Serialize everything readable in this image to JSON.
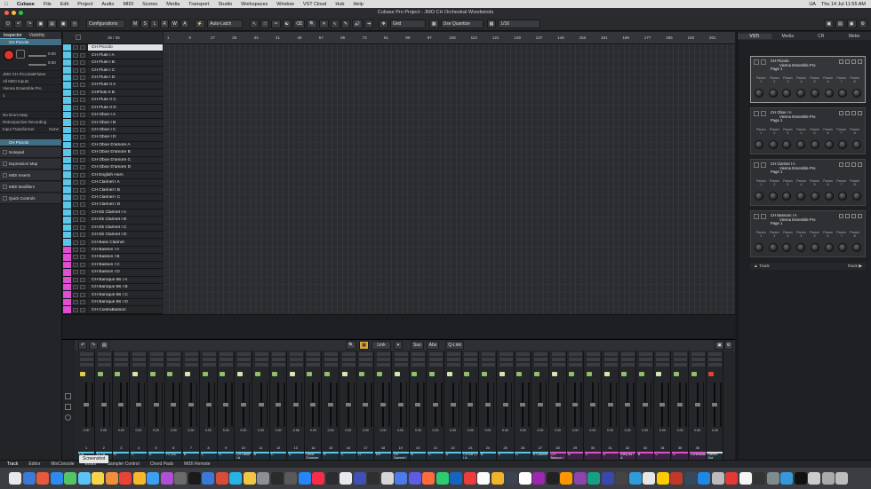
{
  "menubar": {
    "app": "Cubase",
    "items": [
      "File",
      "Edit",
      "Project",
      "Audio",
      "MIDI",
      "Scores",
      "Media",
      "Transport",
      "Studio",
      "Workspaces",
      "Window",
      "VST Cloud",
      "Hub",
      "Help"
    ],
    "clock": "Thu 14 Jul  11:55 AM",
    "lang": "UA"
  },
  "window": {
    "title": "Cubase Pro Project - JMO CH Orchestral Woodwinds"
  },
  "toolbar": {
    "configurations": "Configurations",
    "msrw": [
      "M",
      "S",
      "L",
      "R",
      "W",
      "A"
    ],
    "automation": "Auto-Latch",
    "grid": "Grid",
    "quantize_mode": "Use Quantize",
    "quantize": "1/16"
  },
  "inspector": {
    "tabs": [
      "Inspector",
      "Visibility"
    ],
    "track": "CH Piccolo",
    "vol": "0.00",
    "pan": "0.00",
    "rows": [
      "JMO CH Piccolo&Flutes",
      "All MIDI Inputs",
      "Vienna Ensemble Pro",
      "1",
      "No Drum Map"
    ],
    "retro": "Retrospective Recording",
    "input_transformer": "Input Transformer",
    "input_transformer_val": "None",
    "routing_track": "CH Piccolo",
    "sections": [
      "Notepad",
      "Expression Map",
      "MIDI Inserts",
      "MIDI Modifiers",
      "Quick Controls"
    ]
  },
  "tracklist": {
    "counter": "36 / 36",
    "tracks": [
      "CH Piccolo",
      "CH Flute I A",
      "CH Flute I B",
      "CH Flute I C",
      "CH Flute I D",
      "CH Flute II A",
      "CHFlute II B",
      "CH Flute II C",
      "CH Flute II D",
      "CH Oboe I A",
      "CH Oboe I B",
      "CH Oboe I C",
      "CH Oboe I D",
      "CH Oboe D'amore A",
      "CH Oboe D'amore B",
      "CH Oboe D'amore C",
      "CH Oboe D'amore D",
      "CH English Horn",
      "CH Clarinet I A",
      "CH Clarinet I B",
      "CH Clarinet I C",
      "CH Clarinet I D",
      "CH Eb Clarinet I A",
      "CH Eb Clarinet I B",
      "CH Eb Clarinet I C",
      "CH Eb Clarinet I D",
      "CH Bass Clarinet",
      "CH Basson I A",
      "CH Basson I B",
      "CH Basson I C",
      "CH Basson I D",
      "CH Baroque Bs I A",
      "CH Baroque Bs I B",
      "CH Baroque Bs I C",
      "CH Baroque Bs I D",
      "CH ContraBasson"
    ],
    "colors": [
      "#5bc6e8",
      "#5bc6e8",
      "#5bc6e8",
      "#5bc6e8",
      "#5bc6e8",
      "#5bc6e8",
      "#5bc6e8",
      "#5bc6e8",
      "#5bc6e8",
      "#5bc6e8",
      "#5bc6e8",
      "#5bc6e8",
      "#5bc6e8",
      "#5bc6e8",
      "#5bc6e8",
      "#5bc6e8",
      "#5bc6e8",
      "#5bc6e8",
      "#5bc6e8",
      "#5bc6e8",
      "#5bc6e8",
      "#5bc6e8",
      "#5bc6e8",
      "#5bc6e8",
      "#5bc6e8",
      "#5bc6e8",
      "#5bc6e8",
      "#e04fd0",
      "#e04fd0",
      "#e04fd0",
      "#e04fd0",
      "#e04fd0",
      "#e04fd0",
      "#e04fd0",
      "#e04fd0",
      "#e04fd0"
    ]
  },
  "ruler": {
    "bars": [
      "1",
      "9",
      "17",
      "25",
      "33",
      "41",
      "49",
      "57",
      "65",
      "73",
      "81",
      "89",
      "97",
      "105",
      "113",
      "121",
      "129",
      "137",
      "145",
      "153",
      "161",
      "169",
      "177",
      "185",
      "193",
      "201"
    ]
  },
  "vsti": {
    "tabs": [
      "VSTi",
      "Media",
      "CR",
      "Meter"
    ],
    "slots": [
      {
        "name": "CH Piccolo",
        "plugin": "Vienna Ensemble Pro",
        "page": "Page 1"
      },
      {
        "name": "CH Oboe I A",
        "plugin": "Vienna Ensemble Pro",
        "page": "Page 1"
      },
      {
        "name": "CH Clarinet I A",
        "plugin": "Vienna Ensemble Pro",
        "page": "Page 1"
      },
      {
        "name": "CH Bassoon I A",
        "plugin": "Vienna Ensemble Pro",
        "page": "Page 1"
      }
    ],
    "param_label": "Param",
    "param_nums": [
      "1",
      "2",
      "3",
      "4",
      "5",
      "6",
      "7",
      "8"
    ],
    "footer_left": "Track",
    "footer_right": "Rack"
  },
  "mixer": {
    "link": "Link",
    "sus": "Sus",
    "abs": "Abs",
    "qlink": "Q-Link",
    "channels": [
      {
        "num": "1",
        "label": "CH Piccolo",
        "val": "0.00",
        "color": "#5bc6e8"
      },
      {
        "num": "2",
        "label": "FL I A",
        "val": "0.00",
        "color": "#5bc6e8"
      },
      {
        "num": "3",
        "label": "B",
        "val": "0.00",
        "color": "#5bc6e8"
      },
      {
        "num": "4",
        "label": "C",
        "val": "0.00",
        "color": "#5bc6e8"
      },
      {
        "num": "5",
        "label": "D",
        "val": "0.00",
        "color": "#5bc6e8"
      },
      {
        "num": "6",
        "label": "FL II A",
        "val": "0.00",
        "color": "#5bc6e8"
      },
      {
        "num": "7",
        "label": "B",
        "val": "0.00",
        "color": "#5bc6e8"
      },
      {
        "num": "8",
        "label": "C",
        "val": "0.00",
        "color": "#5bc6e8"
      },
      {
        "num": "9",
        "label": "D",
        "val": "5.49",
        "color": "#5bc6e8"
      },
      {
        "num": "10",
        "label": "CH Oboe I A",
        "val": "0.00",
        "color": "#5bc6e8"
      },
      {
        "num": "11",
        "label": "B",
        "val": "0.00",
        "color": "#5bc6e8"
      },
      {
        "num": "12",
        "label": "C",
        "val": "0.00",
        "color": "#5bc6e8"
      },
      {
        "num": "13",
        "label": "D",
        "val": "-0.56",
        "color": "#5bc6e8"
      },
      {
        "num": "14",
        "label": "Oboe D'amore",
        "val": "0.00",
        "color": "#5bc6e8"
      },
      {
        "num": "15",
        "label": "B",
        "val": "0.00",
        "color": "#5bc6e8"
      },
      {
        "num": "16",
        "label": "C",
        "val": "0.00",
        "color": "#5bc6e8"
      },
      {
        "num": "17",
        "label": "D",
        "val": "0.00",
        "color": "#5bc6e8"
      },
      {
        "num": "18",
        "label": "EH",
        "val": "0.00",
        "color": "#5bc6e8"
      },
      {
        "num": "19",
        "label": "CH Clarinet I",
        "val": "0.00",
        "color": "#5bc6e8"
      },
      {
        "num": "20",
        "label": "B",
        "val": "0.00",
        "color": "#5bc6e8"
      },
      {
        "num": "21",
        "label": "C",
        "val": "0.00",
        "color": "#5bc6e8"
      },
      {
        "num": "22",
        "label": "D",
        "val": "0.00",
        "color": "#5bc6e8"
      },
      {
        "num": "23",
        "label": "CH Eb Cl I A",
        "val": "0.00",
        "color": "#5bc6e8"
      },
      {
        "num": "24",
        "label": "B",
        "val": "0.00",
        "color": "#5bc6e8"
      },
      {
        "num": "25",
        "label": "C",
        "val": "0.00",
        "color": "#5bc6e8"
      },
      {
        "num": "26",
        "label": "D",
        "val": "0.00",
        "color": "#5bc6e8"
      },
      {
        "num": "27",
        "label": "B Clarinet",
        "val": "0.00",
        "color": "#5bc6e8"
      },
      {
        "num": "28",
        "label": "CH Basson I",
        "val": "0.00",
        "color": "#e04fd0"
      },
      {
        "num": "29",
        "label": "B",
        "val": "0.00",
        "color": "#e04fd0"
      },
      {
        "num": "30",
        "label": "C",
        "val": "0.00",
        "color": "#e04fd0"
      },
      {
        "num": "31",
        "label": "D",
        "val": "0.00",
        "color": "#e04fd0"
      },
      {
        "num": "32",
        "label": "Barq Bs I A",
        "val": "0.00",
        "color": "#e04fd0"
      },
      {
        "num": "33",
        "label": "B",
        "val": "0.00",
        "color": "#e04fd0"
      },
      {
        "num": "34",
        "label": "C",
        "val": "0.00",
        "color": "#e04fd0"
      },
      {
        "num": "35",
        "label": "D",
        "val": "0.00",
        "color": "#e04fd0"
      },
      {
        "num": "36",
        "label": "Contrabasson",
        "val": "0.00",
        "color": "#e04fd0"
      },
      {
        "num": "",
        "label": "Stereo Out",
        "val": "0.00",
        "color": "#dddddd"
      }
    ]
  },
  "bottomtabs": [
    "Track",
    "Editor",
    "MixConsole",
    "Editor",
    "Sampler Control",
    "Chord Pads",
    "MIDI Remote"
  ],
  "tooltip": "Screenshot",
  "dock": {
    "colors": [
      "#e9e9ea",
      "#3a7bd5",
      "#e6593b",
      "#2d8bf0",
      "#53c567",
      "#5cc3f5",
      "#f7d34a",
      "#f08f3a",
      "#ea4335",
      "#f9b82b",
      "#3ba0f0",
      "#b04fd4",
      "#6b6b6b",
      "#1a1a1a",
      "#3a79d8",
      "#d84c3a",
      "#26b3e8",
      "#f2c643",
      "#8e8e93",
      "#2b2b2b",
      "#5a5a5a",
      "#2684fc",
      "#fa2d48",
      "#2c2c2e",
      "#e8e8ea",
      "#3f51b5",
      "#2f2f2f",
      "#d6d6d6",
      "#4b7bec",
      "#5e5ce6",
      "#ff6b3d",
      "#2ecc71",
      "#1565c0",
      "#ee3b3b",
      "#fafafa",
      "#f0b429",
      "#3b4252",
      "#ffffff",
      "#9c27b0",
      "#222222",
      "#ff9500",
      "#8e44ad",
      "#16a085",
      "#3949ab",
      "#444444",
      "#2d9cdb",
      "#e6e6e6",
      "#ffcc00",
      "#c0392b",
      "#34495e",
      "#1e88e5",
      "#bbbbbb",
      "#e53935",
      "#f5f5f5",
      "#333333",
      "#7f8c8d",
      "#3498db",
      "#111111",
      "#cccccc",
      "#aaaaaa",
      "#bdbdbd"
    ]
  }
}
